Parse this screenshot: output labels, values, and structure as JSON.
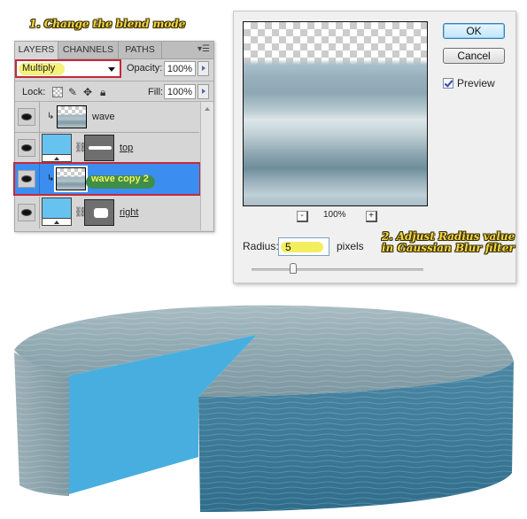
{
  "annotations": {
    "step1": "1. Change the blend mode",
    "step2_line1": "2. Adjust Radius value",
    "step2_line2": "in Gaussian Blur filter"
  },
  "layers_panel": {
    "tabs": [
      {
        "label": "LAYERS",
        "active": true
      },
      {
        "label": "CHANNELS",
        "active": false
      },
      {
        "label": "PATHS",
        "active": false
      }
    ],
    "panel_menu_icon": "panel-menu-icon",
    "blend_mode": "Multiply",
    "opacity_label": "Opacity:",
    "opacity_value": "100%",
    "lock_label": "Lock:",
    "lock_icons": [
      "lock-transparent-icon",
      "lock-paint-icon",
      "lock-move-icon",
      "lock-all-icon"
    ],
    "fill_label": "Fill:",
    "fill_value": "100%",
    "layers": [
      {
        "name": "wave",
        "visible": true,
        "clipped": true,
        "selected": false
      },
      {
        "name": "top",
        "visible": true,
        "clipped": false,
        "selected": false,
        "has_mask": true
      },
      {
        "name": "wave copy 2",
        "visible": true,
        "clipped": true,
        "selected": true
      },
      {
        "name": "right",
        "visible": true,
        "clipped": false,
        "selected": false,
        "has_mask": true
      }
    ]
  },
  "blur_dialog": {
    "ok_label": "OK",
    "cancel_label": "Cancel",
    "preview_label": "Preview",
    "preview_checked": true,
    "zoom_out_label": "-",
    "zoom_in_label": "+",
    "zoom_level": "100%",
    "radius_label": "Radius:",
    "radius_value": "5",
    "radius_unit": "pixels",
    "slider_position_fraction": 0.24
  },
  "colors": {
    "highlight_red": "#c4283a",
    "selection_blue": "#3b8ef0",
    "annotation_yellow": "#f2d64a",
    "cut_face_blue": "#48aee0"
  }
}
